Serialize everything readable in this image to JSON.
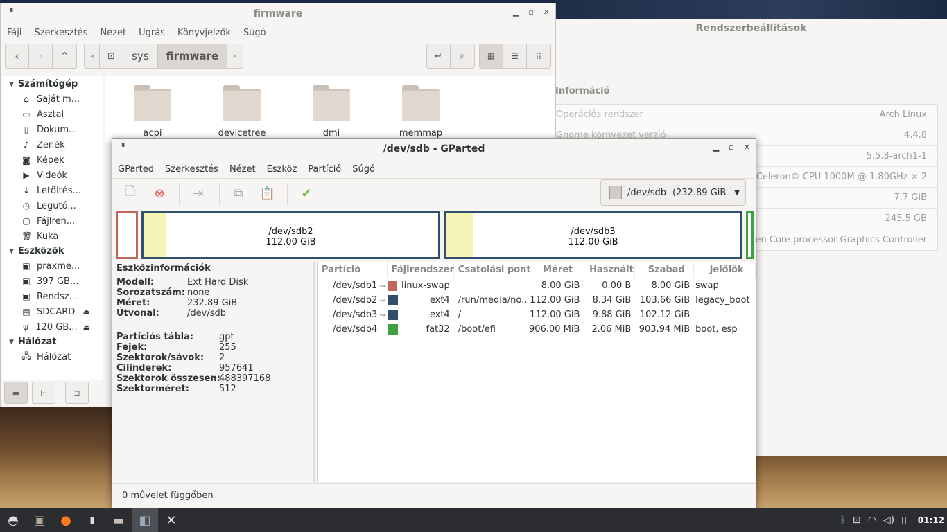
{
  "settings": {
    "title": "Rendszerbeállítások",
    "section": "Információ",
    "rows": [
      {
        "key": "Operációs rendszer",
        "value": "Arch Linux"
      },
      {
        "key": "Gnome környezet verzió",
        "value": "4.4.8"
      },
      {
        "key": "",
        "value": "5.5.3-arch1-1"
      },
      {
        "key": "",
        "value": "Intel® Celeron© CPU 1000M @ 1.80GHz × 2"
      },
      {
        "key": "",
        "value": "7.7 GiB"
      },
      {
        "key": "",
        "value": "245.5 GB"
      },
      {
        "key": "",
        "value": "Intel® 3rd Gen Core processor Graphics Controller"
      }
    ]
  },
  "filemanager": {
    "title": "firmware",
    "menu": [
      "Fájl",
      "Szerkesztés",
      "Nézet",
      "Ugrás",
      "Könyvjelzők",
      "Súgó"
    ],
    "breadcrumb": [
      "sys",
      "firmware"
    ],
    "sidebar": {
      "computer_header": "Számítógép",
      "computer_items": [
        {
          "label": "Saját m...",
          "icon": "home-icon"
        },
        {
          "label": "Asztal",
          "icon": "desktop-icon"
        },
        {
          "label": "Dokum...",
          "icon": "document-icon"
        },
        {
          "label": "Zenék",
          "icon": "music-icon"
        },
        {
          "label": "Képek",
          "icon": "camera-icon"
        },
        {
          "label": "Videók",
          "icon": "video-icon"
        },
        {
          "label": "Letöltés...",
          "icon": "download-icon"
        },
        {
          "label": "Legutó...",
          "icon": "clock-icon"
        },
        {
          "label": "Fájlren...",
          "icon": "filesystem-icon"
        },
        {
          "label": "Kuka",
          "icon": "trash-icon"
        }
      ],
      "devices_header": "Eszközök",
      "devices_items": [
        {
          "label": "praxme...",
          "icon": "drive-icon",
          "eject": false
        },
        {
          "label": "397 GB...",
          "icon": "drive-icon",
          "eject": false
        },
        {
          "label": "Rendsz...",
          "icon": "drive-icon",
          "eject": false
        },
        {
          "label": "SDCARD",
          "icon": "sdcard-icon",
          "eject": true
        },
        {
          "label": "120 GB...",
          "icon": "usb-icon",
          "eject": true
        }
      ],
      "network_header": "Hálózat",
      "network_items": [
        {
          "label": "Hálózat",
          "icon": "network-icon"
        }
      ]
    },
    "folders": [
      "acpi",
      "devicetree",
      "dmi",
      "memmap"
    ]
  },
  "gparted": {
    "title": "/dev/sdb - GParted",
    "menu": [
      "GParted",
      "Szerkesztés",
      "Nézet",
      "Eszköz",
      "Partíció",
      "Súgó"
    ],
    "device": {
      "name": "/dev/sdb",
      "size": "(232.89 GiB"
    },
    "map": [
      {
        "name": "/dev/sdb2",
        "size": "112.00 GiB"
      },
      {
        "name": "/dev/sdb3",
        "size": "112.00 GiB"
      }
    ],
    "info": {
      "title": "Eszközinformációk",
      "rows": [
        {
          "k": "Modell:",
          "v": "Ext Hard  Disk"
        },
        {
          "k": "Sorozatszám:",
          "v": "none"
        },
        {
          "k": "Méret:",
          "v": "232.89 GiB"
        },
        {
          "k": "Útvonal:",
          "v": "/dev/sdb"
        }
      ],
      "rows2": [
        {
          "k": "Partíciós tábla:",
          "v": "gpt"
        },
        {
          "k": "Fejek:",
          "v": "255"
        },
        {
          "k": "Szektorok/sávok:",
          "v": "2"
        },
        {
          "k": "Cilinderek:",
          "v": "957641"
        },
        {
          "k": "Szektorok összesen:",
          "v": "488397168"
        },
        {
          "k": "Szektorméret:",
          "v": "512"
        }
      ]
    },
    "columns": [
      "Partíció",
      "Fájlrendszer",
      "Csatolási pont",
      "Méret",
      "Használt",
      "Szabad",
      "Jelölők"
    ],
    "partitions": [
      {
        "name": "/dev/sdb1",
        "fs": "linux-swap",
        "color": "#c1665a",
        "mount": "",
        "size": "8.00 GiB",
        "used": "0.00 B",
        "free": "8.00 GiB",
        "flags": "swap",
        "key": true
      },
      {
        "name": "/dev/sdb2",
        "fs": "ext4",
        "color": "#314e6c",
        "mount": "/run/media/no...",
        "size": "112.00 GiB",
        "used": "8.34 GiB",
        "free": "103.66 GiB",
        "flags": "legacy_boot",
        "key": true
      },
      {
        "name": "/dev/sdb3",
        "fs": "ext4",
        "color": "#314e6c",
        "mount": "/",
        "size": "112.00 GiB",
        "used": "9.88 GiB",
        "free": "102.12 GiB",
        "flags": "",
        "key": true
      },
      {
        "name": "/dev/sdb4",
        "fs": "fat32",
        "color": "#3fa13f",
        "mount": "/boot/efi",
        "size": "906.00 MiB",
        "used": "2.06 MiB",
        "free": "903.94 MiB",
        "flags": "boot, esp",
        "key": false
      }
    ],
    "status": "0 művelet függőben"
  },
  "taskbar": {
    "clock": "01:12"
  }
}
